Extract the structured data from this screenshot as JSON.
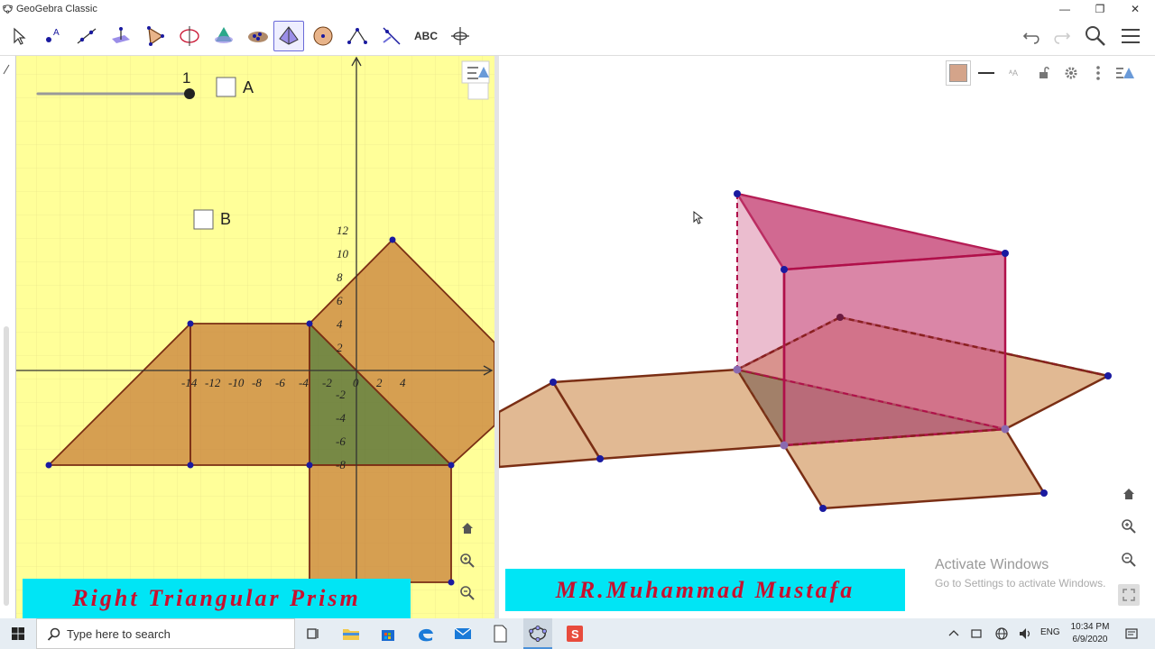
{
  "window": {
    "title": "GeoGebra Classic",
    "minimize": "—",
    "restore": "❐",
    "close": "✕"
  },
  "toolbar": {
    "tools": [
      "move-tool",
      "point-tool",
      "line-tool",
      "perpendicular-line-tool",
      "polygon-tool",
      "circle-axis-tool",
      "intersect-tool",
      "plane-tool",
      "pyramid-tool",
      "sphere-tool",
      "angle-tool",
      "reflect-tool",
      "text-tool",
      "rotate-view-tool"
    ],
    "text_tool_label": "ABC",
    "active_tool": "pyramid-tool"
  },
  "graphics2d": {
    "background": "#ffff99",
    "slider_value": "1",
    "checkbox_a_label": "A",
    "checkbox_b_label": "B",
    "x_ticks": [
      "-14",
      "-12",
      "-10",
      "-8",
      "-6",
      "-4",
      "-2",
      "0",
      "2",
      "4"
    ],
    "y_ticks": [
      "12",
      "10",
      "8",
      "6",
      "4",
      "2",
      "-2",
      "-4",
      "-6",
      "-8"
    ]
  },
  "banners": {
    "left": "Right Triangular Prism",
    "right": "MR.Muhammad Mustafa"
  },
  "watermark": {
    "line1": "Activate Windows",
    "line2": "Go to Settings to activate Windows."
  },
  "taskbar": {
    "search_placeholder": "Type here to search",
    "time": "10:34 PM",
    "date": "6/9/2020",
    "language": "ENG"
  },
  "colors": {
    "net_fill": "#c87f3a",
    "prism_fill": "#cc5a86",
    "banner_bg": "#00e5f5",
    "banner_text": "#c8102e"
  }
}
